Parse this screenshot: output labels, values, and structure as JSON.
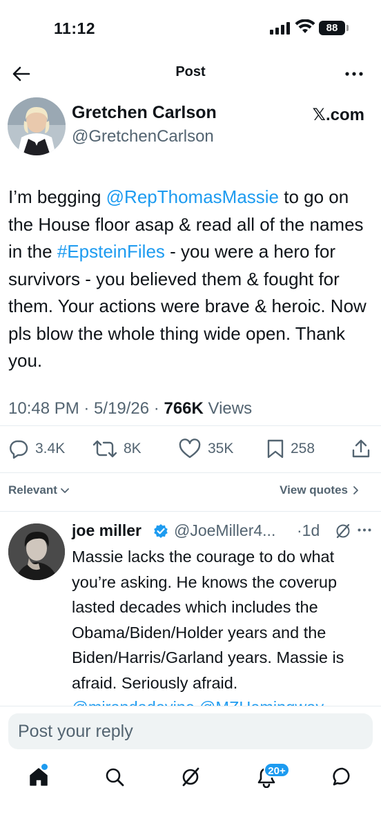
{
  "status_bar": {
    "time": "11:12",
    "battery": "88"
  },
  "header": {
    "title": "Post"
  },
  "post": {
    "author_name": "Gretchen Carlson",
    "author_handle": "@GretchenCarlson",
    "source": "𝕏.com",
    "text_before_mention": "I’m begging ",
    "mention": "@RepThomasMassie",
    "text_after_mention": " to go on the House floor asap & read all of the names in the ",
    "hashtag": "#EpsteinFiles",
    "text_after_hashtag": " - you were a hero for survivors - you believed them & fought for them. Your actions were brave & heroic. Now pls blow the whole thing wide open. Thank you.",
    "timestamp": "10:48 PM · 5/19/26 · ",
    "views_count": "766K",
    "views_label": " Views",
    "replies": "3.4K",
    "reposts": "8K",
    "likes": "35K",
    "bookmarks": "258"
  },
  "filter": {
    "relevant": "Relevant",
    "view_quotes": "View quotes"
  },
  "reply": {
    "name": "joe miller",
    "handle": "@JoeMiller4...",
    "time": "·1d",
    "text": "Massie lacks the courage to do what you’re asking. He knows the coverup lasted decades which includes the Obama/Biden/Holder years and the Biden/Harris/Garland years. Massie is afraid. Seriously afraid.",
    "mentions": "@mirandadevine @MZHemingway"
  },
  "composer": {
    "placeholder": "Post your reply"
  },
  "nav": {
    "notifications_badge": "20+"
  },
  "colors": {
    "accent": "#1d9bf0",
    "text": "#0f1419",
    "muted": "#536471"
  }
}
